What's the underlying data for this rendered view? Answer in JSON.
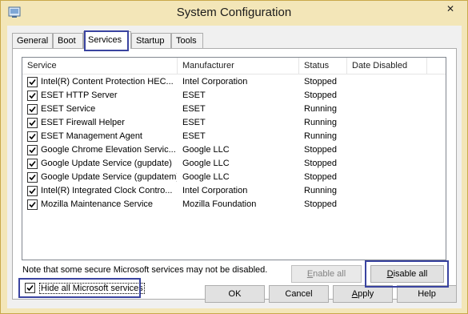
{
  "window": {
    "title": "System Configuration",
    "close_glyph": "✕"
  },
  "tabs": [
    {
      "label": "General"
    },
    {
      "label": "Boot"
    },
    {
      "label": "Services"
    },
    {
      "label": "Startup"
    },
    {
      "label": "Tools"
    }
  ],
  "active_tab": "Services",
  "table": {
    "headers": [
      "Service",
      "Manufacturer",
      "Status",
      "Date Disabled"
    ],
    "rows": [
      {
        "service": "Intel(R) Content Protection HEC...",
        "manufacturer": "Intel Corporation",
        "status": "Stopped",
        "date_disabled": "",
        "checked": true
      },
      {
        "service": "ESET HTTP Server",
        "manufacturer": "ESET",
        "status": "Stopped",
        "date_disabled": "",
        "checked": true
      },
      {
        "service": "ESET Service",
        "manufacturer": "ESET",
        "status": "Running",
        "date_disabled": "",
        "checked": true
      },
      {
        "service": "ESET Firewall Helper",
        "manufacturer": "ESET",
        "status": "Running",
        "date_disabled": "",
        "checked": true
      },
      {
        "service": "ESET Management Agent",
        "manufacturer": "ESET",
        "status": "Running",
        "date_disabled": "",
        "checked": true
      },
      {
        "service": "Google Chrome Elevation Servic...",
        "manufacturer": "Google LLC",
        "status": "Stopped",
        "date_disabled": "",
        "checked": true
      },
      {
        "service": "Google Update Service (gupdate)",
        "manufacturer": "Google LLC",
        "status": "Stopped",
        "date_disabled": "",
        "checked": true
      },
      {
        "service": "Google Update Service (gupdatem)",
        "manufacturer": "Google LLC",
        "status": "Stopped",
        "date_disabled": "",
        "checked": true
      },
      {
        "service": "Intel(R) Integrated Clock Contro...",
        "manufacturer": "Intel Corporation",
        "status": "Running",
        "date_disabled": "",
        "checked": true
      },
      {
        "service": "Mozilla Maintenance Service",
        "manufacturer": "Mozilla Foundation",
        "status": "Stopped",
        "date_disabled": "",
        "checked": true
      }
    ]
  },
  "note": "Note that some secure Microsoft services may not be disabled.",
  "buttons": {
    "enable_all": "Enable all",
    "disable_all": "Disable all",
    "ok": "OK",
    "cancel": "Cancel",
    "apply": "Apply",
    "help": "Help"
  },
  "hide_ms": {
    "label": "Hide all Microsoft services",
    "checked": true
  },
  "colors": {
    "titlebar": "#f3e6b8",
    "highlight_box": "#3a44a0"
  }
}
